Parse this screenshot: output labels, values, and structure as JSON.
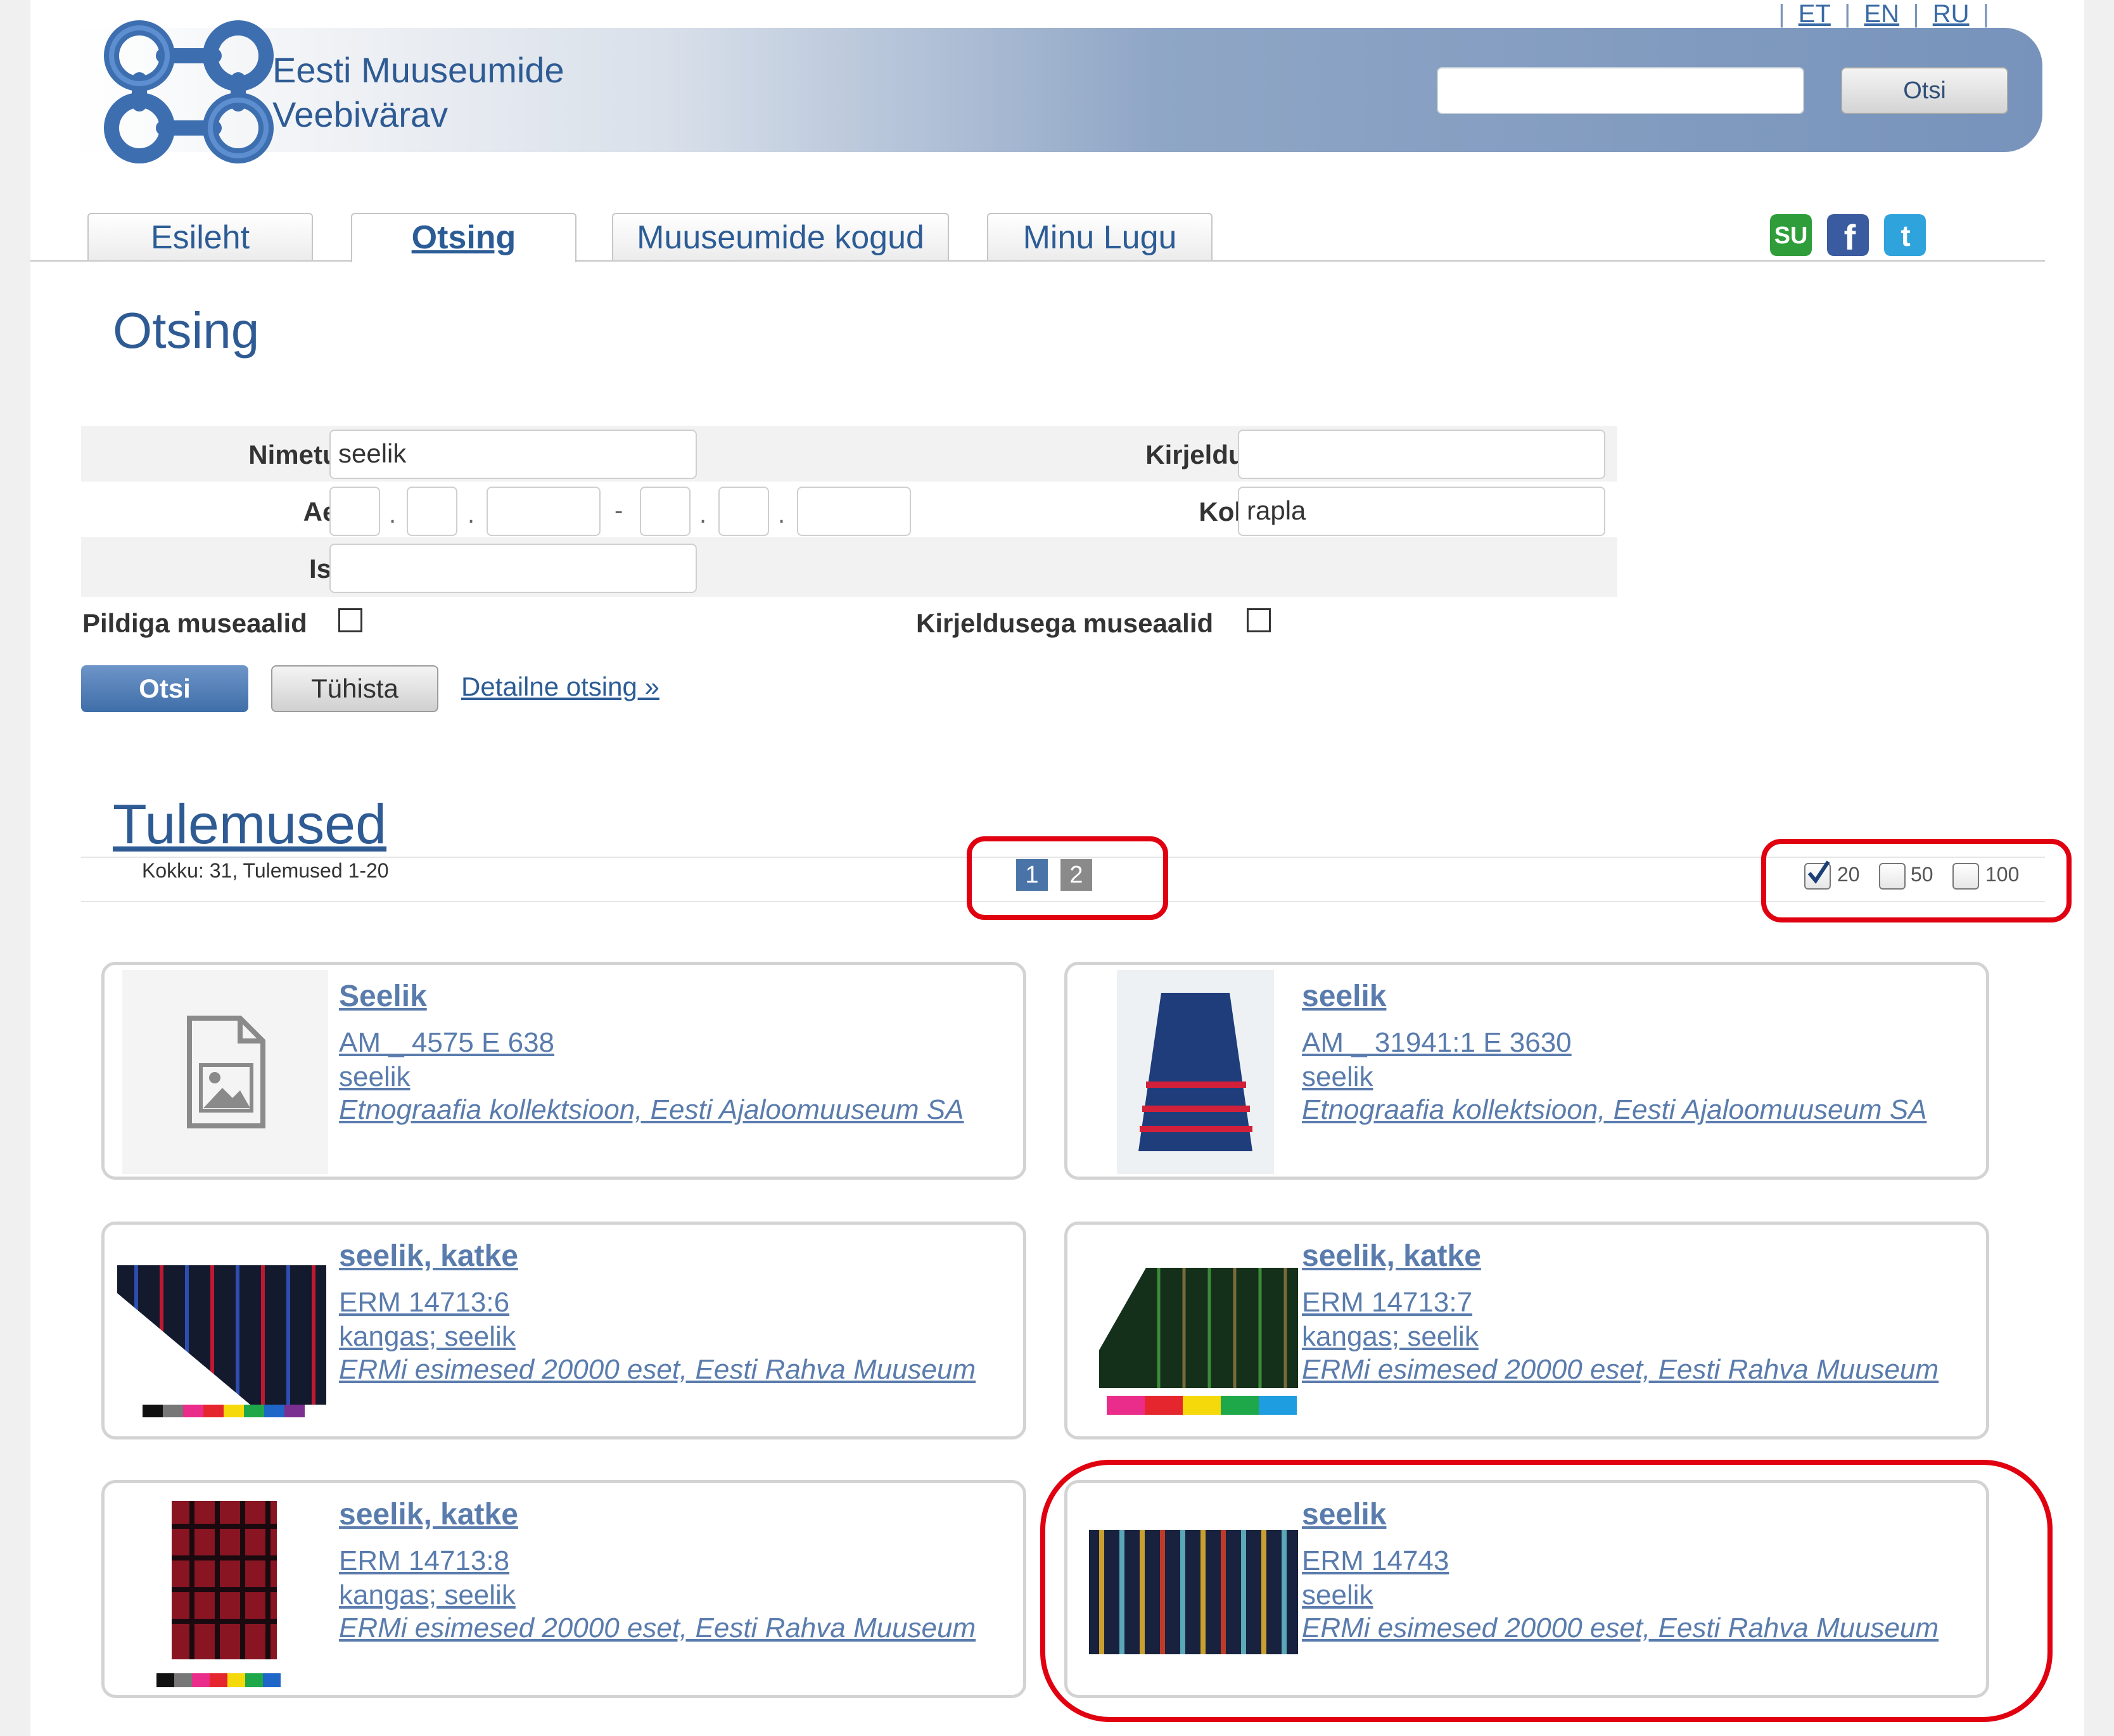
{
  "languages": [
    "ET",
    "EN",
    "RU"
  ],
  "header": {
    "site_title_line1": "Eesti Muuseumide",
    "site_title_line2": "Veebivärav",
    "search_value": "",
    "search_button": "Otsi"
  },
  "tabs": [
    "Esileht",
    "Otsing",
    "Muuseumide kogud",
    "Minu Lugu"
  ],
  "active_tab": "Otsing",
  "social": [
    "stumbleupon-icon",
    "facebook-icon",
    "twitter-icon"
  ],
  "search": {
    "title": "Otsing",
    "nimetus_label": "Nimetus",
    "nimetus_value": "seelik",
    "kirjeldus_label": "Kirjeldus",
    "kirjeldus_value": "",
    "aeg_label": "Aeg",
    "koht_label": "Koht",
    "koht_value": "rapla",
    "isik_label": "Isik",
    "isik_value": "",
    "pildiga_label": "Pildiga museaalid",
    "pildiga_checked": false,
    "kirjeldusega_label": "Kirjeldusega museaalid",
    "kirjeldusega_checked": false,
    "submit_button": "Otsi",
    "reset_button": "Tühista",
    "detail_link": "Detailne otsing »"
  },
  "results": {
    "title": "Tulemused",
    "count_text": "Kokku: 31, Tulemused 1-20",
    "pages": [
      "1",
      "2"
    ],
    "current_page": "1",
    "per_page_options": [
      "20",
      "50",
      "100"
    ],
    "per_page_selected": "20",
    "items": [
      {
        "title": "Seelik",
        "id": "AM _ 4575 E 638",
        "name": "seelik",
        "collection": "Etnograafia kollektsioon, Eesti Ajaloomuuseum SA",
        "thumb": "placeholder-image-icon"
      },
      {
        "title": "seelik",
        "id": "AM _ 31941:1 E 3630",
        "name": "seelik",
        "collection": "Etnograafia kollektsioon, Eesti Ajaloomuuseum SA",
        "thumb": "blue-skirt-photo"
      },
      {
        "title": "seelik, katke",
        "id": "ERM 14713:6",
        "name": "kangas; seelik",
        "collection": "ERMi esimesed 20000 eset, Eesti Rahva Muuseum",
        "thumb": "striped-fabric-photo"
      },
      {
        "title": "seelik, katke",
        "id": "ERM 14713:7",
        "name": "kangas; seelik",
        "collection": "ERMi esimesed 20000 eset, Eesti Rahva Muuseum",
        "thumb": "green-fabric-photo"
      },
      {
        "title": "seelik, katke",
        "id": "ERM 14713:8",
        "name": "kangas; seelik",
        "collection": "ERMi esimesed 20000 eset, Eesti Rahva Muuseum",
        "thumb": "red-checked-fabric-photo"
      },
      {
        "title": "seelik",
        "id": "ERM 14743",
        "name": "seelik",
        "collection": "ERMi esimesed 20000 eset, Eesti Rahva Muuseum",
        "thumb": "striped-skirt-photo"
      }
    ]
  },
  "colors": {
    "link_blue": "#2c5c95",
    "title_blue": "#2f5b94",
    "annotation_red": "#e00010"
  }
}
